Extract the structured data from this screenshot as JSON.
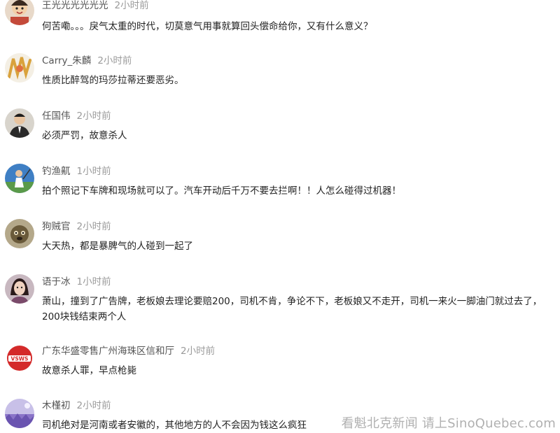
{
  "comments": [
    {
      "username": "王光光光光光光",
      "time": "2小时前",
      "text": "何苦嘞。。。戾气太重的时代，切莫意气用事就算回头偿命给你，又有什么意义？",
      "avatar_color": "#c47a4a"
    },
    {
      "username": "Carry_朱麟",
      "time": "2小时前",
      "text": "性质比醉驾的玛莎拉蒂还要恶劣。",
      "avatar_color": "#d9a23c"
    },
    {
      "username": "任国伟",
      "time": "2小时前",
      "text": "必须严罚，故意杀人",
      "avatar_color": "#3a3a3a"
    },
    {
      "username": "钓渔鼿",
      "time": "1小时前",
      "text": "拍个照记下车牌和现场就可以了。汽车开动后千万不要去拦啊！！人怎么碰得过机器！",
      "avatar_color": "#2f6fb3"
    },
    {
      "username": "狗贼官",
      "time": "2小时前",
      "text": "大天热，都是暴脾气的人碰到一起了",
      "avatar_color": "#8a7a5a"
    },
    {
      "username": "语于冰",
      "time": "1小时前",
      "text": "萧山，撞到了广告牌，老板娘去理论要赔200，司机不肯，争论不下，老板娘又不走开，司机一来火一脚油门就过去了，200块钱结束两个人",
      "avatar_color": "#7a5a6a"
    },
    {
      "username": "广东华盛零售广州海珠区信和厅",
      "time": "2小时前",
      "text": "故意杀人罪，早点枪毙",
      "avatar_color": "#d42a2a"
    },
    {
      "username": "木槿初",
      "time": "2小时前",
      "text": "司机绝对是河南或者安徽的，其他地方的人不会因为钱这么疯狂",
      "avatar_color": "#9a86c8"
    }
  ],
  "watermark": "看魁北克新闻 请上SinoQuebec.com"
}
